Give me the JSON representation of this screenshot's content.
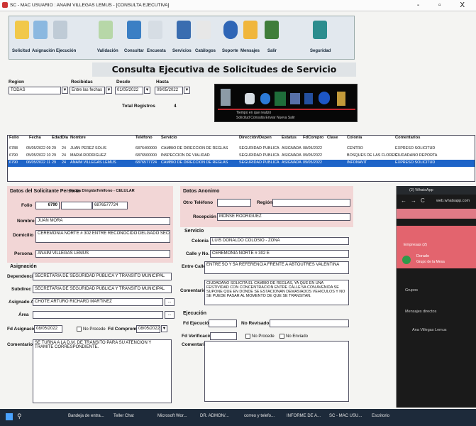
{
  "window": {
    "title": "SC - MAC  USUARIO : ANAIM VILLEGAS LEMUS - [CONSULTA EJECUTIVA]",
    "buttons": "-  ▫  X"
  },
  "toolbar": {
    "items": [
      "Solicitud",
      "Asignación",
      "Ejecución",
      "Validación",
      "Consultar",
      "Encuesta",
      "Servicios",
      "Catálogos",
      "Soporte",
      "Mensajes",
      "Salir",
      "Seguridad"
    ]
  },
  "header": {
    "title": "Consulta Ejecutiva de Solicitudes de Servicio"
  },
  "filters": {
    "region_label": "Region",
    "region_value": "TODAS",
    "recibidas_label": "Recibidas",
    "recibidas_value": "Entre las fechas",
    "desde_label": "Desde",
    "desde_value": "01/05/2022",
    "hasta_label": "Hasta",
    "hasta_value": "09/05/2022",
    "total_label": "Total Registros",
    "total_value": "4"
  },
  "black_panel": {
    "line1": "Tiempo en que realizó",
    "line2": "Solicitud   Consulta   Enviar   Nueva   Salir"
  },
  "grid": {
    "headers": [
      "Folio",
      "Fecha",
      "Edad",
      "Día",
      "Nombre",
      "Teléfono",
      "Servicio",
      "Dirección/Depen",
      "Estatus",
      "FdCompro",
      "Clase",
      "Colonia",
      "Comentarios"
    ],
    "rows": [
      [
        "6788",
        "05/05/2022 09",
        "29",
        "24",
        "JUAN PEREZ SOLIS",
        "6876400000",
        "CAMBIO DE DIRECCION DE REGLAS",
        "SEGURIDAD PUBLICA",
        "ASIGNADA",
        "08/05/2022",
        "",
        "CENTRO",
        "EXPRESO SOLICITUD"
      ],
      [
        "6790",
        "05/05/2022 10",
        "29",
        "24",
        "MARIA RODRIGUEZ",
        "6876500000",
        "INSPECCION DE VIALIDAD",
        "SEGURIDAD PUBLICA",
        "ASIGNADA",
        "09/05/2022",
        "",
        "BOSQUES DE LAS FLORES",
        "CIUDADANO REPORTA"
      ],
      [
        "6790",
        "06/05/2022 11",
        "29",
        "24",
        "ANAIM VILLEGAS LEMUS",
        "6876577724",
        "CAMBIO DE DIRECCION DE REGLAS",
        "SEGURIDAD PUBLICA",
        "ASIGNADA",
        "09/05/2022",
        "",
        "INFONAVIT",
        "EXPRESO SOLICITUD"
      ]
    ]
  },
  "solicitante": {
    "title": "Datos del Solicitante Persona",
    "folio_label": "Folio",
    "folio_value": "6790",
    "fecha_label": "Fecha Dirigida",
    "telefono_label": "Teléfono - CELULAR",
    "telefono_value": "6876577724",
    "nombre_label": "Nombre",
    "nombre_value": "JUAN MORA",
    "domicilio_label": "Domicilio",
    "domicilio_value": "CEREMONIA NORTE # 302 ENTRE RECONOCIDO DELGADO SECCION",
    "persona_label": "Persona",
    "persona_value": "ANAIM VILLEGAS LEMUS"
  },
  "asignacion": {
    "title": "Asignación",
    "dependencia_label": "Dependencia",
    "dependencia_value": "SECRETARIA DE SEGURIDAD PUBLICA Y TRANSITO MUNICIPAL",
    "subdirec_label": "Subdirec",
    "subdirec_value": "SECRETARIA DE SEGURIDAD PUBLICA Y TRANSITO MUNICIPAL",
    "asignado_label": "Asignado A",
    "asignado_value": "CHOTE ARTURO RICHARD MARTINEZ",
    "area_label": "Área",
    "fasig_label": "Fd Asignación",
    "fasig_value": "08/05/2022",
    "no_procede": "No Procede",
    "fcomp_label": "Fd Compromiso",
    "fcomp_value": "08/05/2022",
    "coment_label": "Comentarios",
    "coment_value": "SE TURNA A LA D.M. DE TRANSITO PARA SU ATENCION Y TRAMITE CORRESPONDIENTE."
  },
  "anonimo": {
    "title": "Datos Anonimo",
    "otro_label": "Otro Teléfono",
    "region_label": "Región",
    "recepcion_label": "Recepción",
    "recepcion_value": "MONSE RODRIGUEZ"
  },
  "servicio": {
    "title": "Servicio",
    "colonia_label": "Colonia",
    "colonia_value": "LUIS DONALDO COLOSIO - ZONA",
    "calle_label": "Calle y No.",
    "calle_value": "CEREMONIA NORTE # 302 E",
    "entre_label": "Entre Calles",
    "entre_value": "ENTRE 5O Y 5A  REFERENCIA FRENTE A ABTOUTRES VALENTINA",
    "comentarios_label": "Comentarios",
    "comentarios_value": "CIUDADANO SOLICITA EL CAMBIO DE REGLAS, YA QUE EN UNA FESTIVIDAD CON CONCENTRACION ENTRE CALLE 5A CON AVENIDA SE SUPONE QUE EN DONDE SE ESTACIONAN DEMASIADOS VEHICULOS Y NO SE PUEDE PASAR AL MOMENTO DE QUE SE TRANSITAN."
  },
  "ejecucion": {
    "title": "Ejecución",
    "fejec_label": "Fd Ejecución",
    "rev_label": "No Revisado",
    "fverif_label": "Fd Verificación",
    "no_procede": "No Procede",
    "enviado": "No Enviado",
    "coment_label": "Comentarios"
  },
  "whatsapp": {
    "title": "(2) WhatsApp",
    "url": "web.whatsapp.com",
    "chip": "Empresas (2)",
    "chat_name": "Dorado",
    "chat_sub": "Grupo de la Mesa",
    "grupos": "Grupos",
    "mensajes": "Mensajes directos",
    "user": "Ana Villegas Lemus"
  },
  "taskbar": {
    "items": [
      "Bandeja de entra...",
      "Teller Chat",
      "Microsoft Wor...",
      "DR. ADMON/...",
      "correo y telefo...",
      "INFORME DE A...",
      "SC - MAC  USU...",
      "Escritorio"
    ]
  }
}
